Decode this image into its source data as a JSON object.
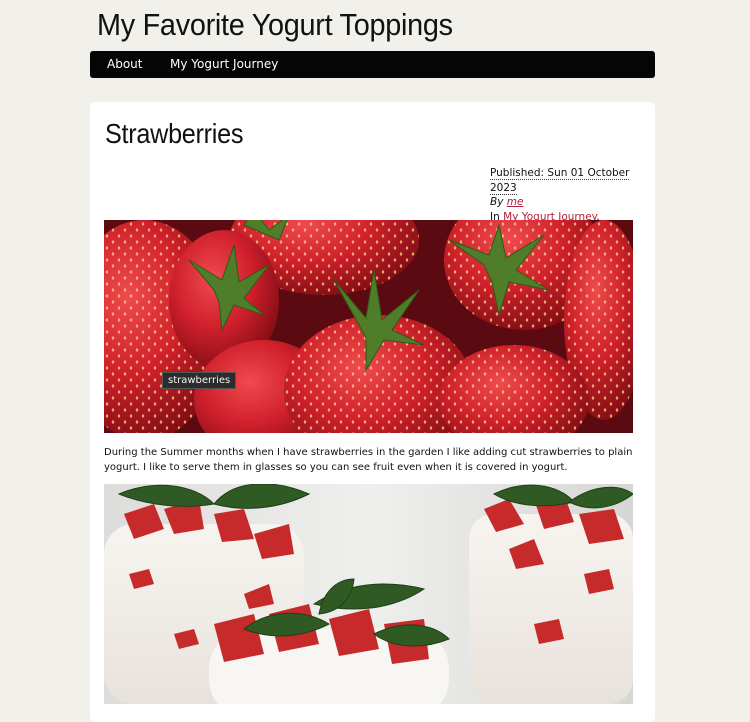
{
  "site": {
    "title": "My Favorite Yogurt Toppings"
  },
  "nav": {
    "items": [
      "About",
      "My Yogurt Journey"
    ]
  },
  "post": {
    "title": "Strawberries",
    "published_label": "Published: Sun 01 October 2023",
    "by_prefix": "By ",
    "author": "me",
    "in_prefix": "In ",
    "category": "My Yogurt Journey",
    "category_suffix": ".",
    "image1_tooltip": "strawberries",
    "paragraph": "During the Summer months when I have strawberries in the garden I like adding cut strawberries to plain yogurt. I like to serve them in glasses so you can see fruit even when it is covered in yogurt."
  },
  "colors": {
    "page_bg": "#f1f0ea",
    "nav_bg": "#050505",
    "link": "#b0213a",
    "strawberry": "#c8202c"
  }
}
